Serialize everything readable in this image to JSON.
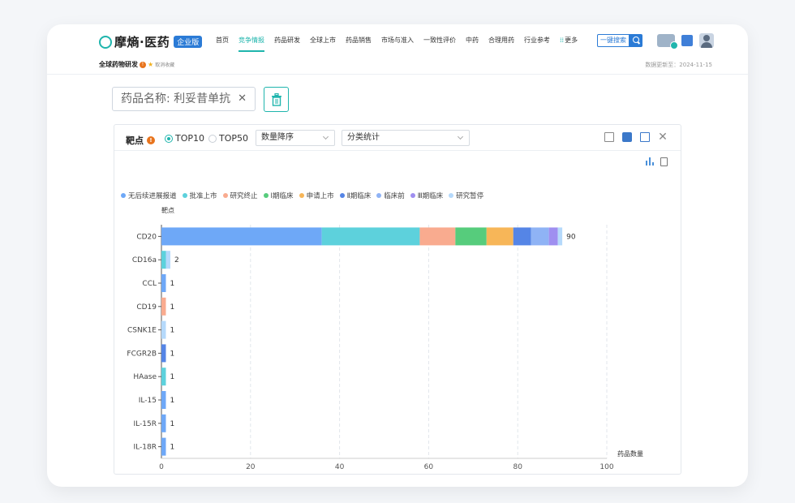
{
  "brand": {
    "name": "摩熵·医药",
    "badge": "企业版",
    "accent": "#1fb5ad"
  },
  "nav": {
    "items": [
      "首页",
      "竞争情报",
      "药品研发",
      "全球上市",
      "药品销售",
      "市场与准入",
      "一致性评价",
      "中药",
      "合理用药",
      "行业参考",
      "更多"
    ],
    "active_index": 1
  },
  "search": {
    "button_label": "一键搜索"
  },
  "page": {
    "title": "全球药物研发",
    "fav_label": "取消收藏",
    "updated": "数据更新至：2024-11-15"
  },
  "filter": {
    "chip_label": "药品名称: 利妥昔单抗"
  },
  "panel": {
    "title": "靶点",
    "radio_top10": "TOP10",
    "radio_top50": "TOP50",
    "selected_radio": "TOP10",
    "sort_select": "数量降序",
    "stat_select": "分类统计"
  },
  "chart_data": {
    "type": "bar",
    "orientation": "horizontal",
    "stacked": true,
    "y_axis_label": "靶点",
    "x_axis_label": "药品数量",
    "xlim": [
      0,
      100
    ],
    "x_ticks": [
      0,
      20,
      40,
      60,
      80,
      100
    ],
    "grid": "vertical dashed",
    "legend_position": "top",
    "categories": [
      "CD20",
      "CD16a",
      "CCL",
      "CD19",
      "CSNK1E",
      "FCGR2B",
      "HAase",
      "IL-15",
      "IL-15R",
      "IL-18R"
    ],
    "totals": [
      90,
      2,
      1,
      1,
      1,
      1,
      1,
      1,
      1,
      1
    ],
    "series": [
      {
        "name": "无后续进展报道",
        "color": "#6ea8f7",
        "values": [
          36,
          0,
          1,
          0,
          0,
          0,
          0,
          1,
          1,
          1
        ]
      },
      {
        "name": "批准上市",
        "color": "#5dd1dc",
        "values": [
          22,
          1,
          0,
          0,
          0,
          0,
          1,
          0,
          0,
          0
        ]
      },
      {
        "name": "研究终止",
        "color": "#f9ab8f",
        "values": [
          8,
          0,
          0,
          1,
          0,
          0,
          0,
          0,
          0,
          0
        ]
      },
      {
        "name": "Ⅰ期临床",
        "color": "#56cc7c",
        "values": [
          7,
          0,
          0,
          0,
          0,
          0,
          0,
          0,
          0,
          0
        ]
      },
      {
        "name": "申请上市",
        "color": "#f7b658",
        "values": [
          6,
          0,
          0,
          0,
          0,
          0,
          0,
          0,
          0,
          0
        ]
      },
      {
        "name": "Ⅱ期临床",
        "color": "#5585e6",
        "values": [
          4,
          0,
          0,
          0,
          0,
          1,
          0,
          0,
          0,
          0
        ]
      },
      {
        "name": "临床前",
        "color": "#8fb3f5",
        "values": [
          4,
          0,
          0,
          0,
          0,
          0,
          0,
          0,
          0,
          0
        ]
      },
      {
        "name": "Ⅲ期临床",
        "color": "#9f8ff0",
        "values": [
          2,
          0,
          0,
          0,
          0,
          0,
          0,
          0,
          0,
          0
        ]
      },
      {
        "name": "研究暂停",
        "color": "#b5d9fb",
        "values": [
          1,
          1,
          0,
          0,
          1,
          0,
          0,
          0,
          0,
          0
        ]
      }
    ]
  }
}
